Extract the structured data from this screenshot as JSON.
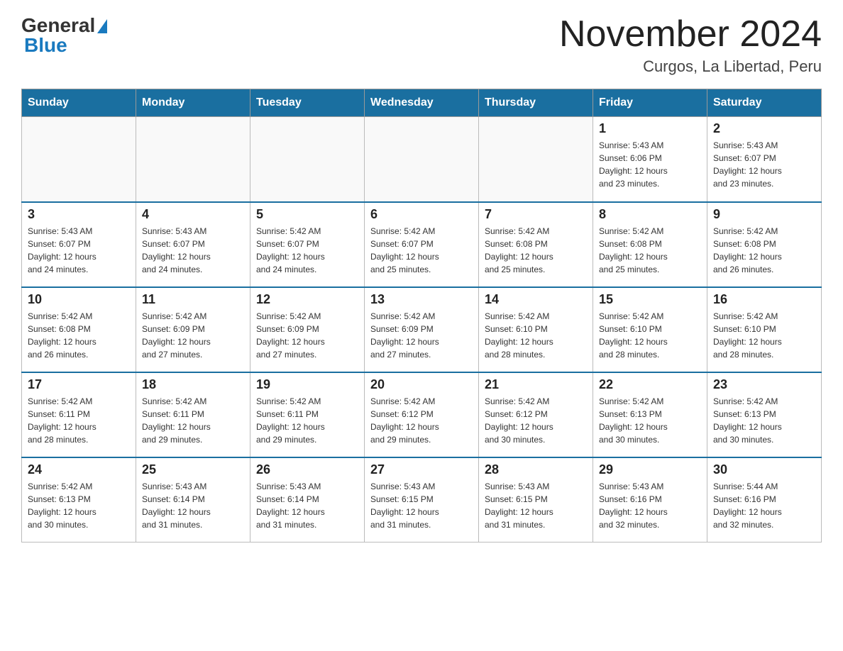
{
  "logo": {
    "general": "General",
    "blue": "Blue"
  },
  "title": "November 2024",
  "subtitle": "Curgos, La Libertad, Peru",
  "weekdays": [
    "Sunday",
    "Monday",
    "Tuesday",
    "Wednesday",
    "Thursday",
    "Friday",
    "Saturday"
  ],
  "weeks": [
    [
      {
        "day": "",
        "info": ""
      },
      {
        "day": "",
        "info": ""
      },
      {
        "day": "",
        "info": ""
      },
      {
        "day": "",
        "info": ""
      },
      {
        "day": "",
        "info": ""
      },
      {
        "day": "1",
        "info": "Sunrise: 5:43 AM\nSunset: 6:06 PM\nDaylight: 12 hours\nand 23 minutes."
      },
      {
        "day": "2",
        "info": "Sunrise: 5:43 AM\nSunset: 6:07 PM\nDaylight: 12 hours\nand 23 minutes."
      }
    ],
    [
      {
        "day": "3",
        "info": "Sunrise: 5:43 AM\nSunset: 6:07 PM\nDaylight: 12 hours\nand 24 minutes."
      },
      {
        "day": "4",
        "info": "Sunrise: 5:43 AM\nSunset: 6:07 PM\nDaylight: 12 hours\nand 24 minutes."
      },
      {
        "day": "5",
        "info": "Sunrise: 5:42 AM\nSunset: 6:07 PM\nDaylight: 12 hours\nand 24 minutes."
      },
      {
        "day": "6",
        "info": "Sunrise: 5:42 AM\nSunset: 6:07 PM\nDaylight: 12 hours\nand 25 minutes."
      },
      {
        "day": "7",
        "info": "Sunrise: 5:42 AM\nSunset: 6:08 PM\nDaylight: 12 hours\nand 25 minutes."
      },
      {
        "day": "8",
        "info": "Sunrise: 5:42 AM\nSunset: 6:08 PM\nDaylight: 12 hours\nand 25 minutes."
      },
      {
        "day": "9",
        "info": "Sunrise: 5:42 AM\nSunset: 6:08 PM\nDaylight: 12 hours\nand 26 minutes."
      }
    ],
    [
      {
        "day": "10",
        "info": "Sunrise: 5:42 AM\nSunset: 6:08 PM\nDaylight: 12 hours\nand 26 minutes."
      },
      {
        "day": "11",
        "info": "Sunrise: 5:42 AM\nSunset: 6:09 PM\nDaylight: 12 hours\nand 27 minutes."
      },
      {
        "day": "12",
        "info": "Sunrise: 5:42 AM\nSunset: 6:09 PM\nDaylight: 12 hours\nand 27 minutes."
      },
      {
        "day": "13",
        "info": "Sunrise: 5:42 AM\nSunset: 6:09 PM\nDaylight: 12 hours\nand 27 minutes."
      },
      {
        "day": "14",
        "info": "Sunrise: 5:42 AM\nSunset: 6:10 PM\nDaylight: 12 hours\nand 28 minutes."
      },
      {
        "day": "15",
        "info": "Sunrise: 5:42 AM\nSunset: 6:10 PM\nDaylight: 12 hours\nand 28 minutes."
      },
      {
        "day": "16",
        "info": "Sunrise: 5:42 AM\nSunset: 6:10 PM\nDaylight: 12 hours\nand 28 minutes."
      }
    ],
    [
      {
        "day": "17",
        "info": "Sunrise: 5:42 AM\nSunset: 6:11 PM\nDaylight: 12 hours\nand 28 minutes."
      },
      {
        "day": "18",
        "info": "Sunrise: 5:42 AM\nSunset: 6:11 PM\nDaylight: 12 hours\nand 29 minutes."
      },
      {
        "day": "19",
        "info": "Sunrise: 5:42 AM\nSunset: 6:11 PM\nDaylight: 12 hours\nand 29 minutes."
      },
      {
        "day": "20",
        "info": "Sunrise: 5:42 AM\nSunset: 6:12 PM\nDaylight: 12 hours\nand 29 minutes."
      },
      {
        "day": "21",
        "info": "Sunrise: 5:42 AM\nSunset: 6:12 PM\nDaylight: 12 hours\nand 30 minutes."
      },
      {
        "day": "22",
        "info": "Sunrise: 5:42 AM\nSunset: 6:13 PM\nDaylight: 12 hours\nand 30 minutes."
      },
      {
        "day": "23",
        "info": "Sunrise: 5:42 AM\nSunset: 6:13 PM\nDaylight: 12 hours\nand 30 minutes."
      }
    ],
    [
      {
        "day": "24",
        "info": "Sunrise: 5:42 AM\nSunset: 6:13 PM\nDaylight: 12 hours\nand 30 minutes."
      },
      {
        "day": "25",
        "info": "Sunrise: 5:43 AM\nSunset: 6:14 PM\nDaylight: 12 hours\nand 31 minutes."
      },
      {
        "day": "26",
        "info": "Sunrise: 5:43 AM\nSunset: 6:14 PM\nDaylight: 12 hours\nand 31 minutes."
      },
      {
        "day": "27",
        "info": "Sunrise: 5:43 AM\nSunset: 6:15 PM\nDaylight: 12 hours\nand 31 minutes."
      },
      {
        "day": "28",
        "info": "Sunrise: 5:43 AM\nSunset: 6:15 PM\nDaylight: 12 hours\nand 31 minutes."
      },
      {
        "day": "29",
        "info": "Sunrise: 5:43 AM\nSunset: 6:16 PM\nDaylight: 12 hours\nand 32 minutes."
      },
      {
        "day": "30",
        "info": "Sunrise: 5:44 AM\nSunset: 6:16 PM\nDaylight: 12 hours\nand 32 minutes."
      }
    ]
  ]
}
